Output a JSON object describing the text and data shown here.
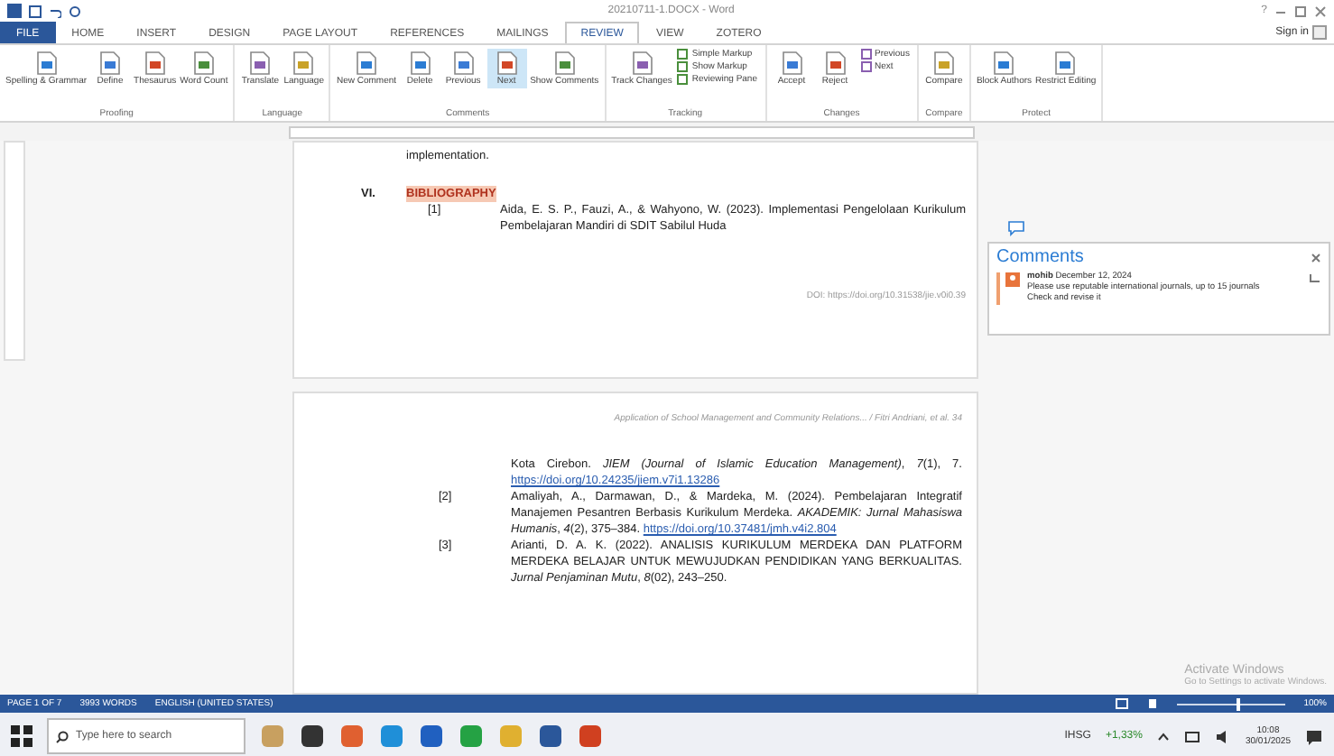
{
  "window": {
    "title": "20210711-1.DOCX - Word",
    "help": "?",
    "sign_in": "Sign in"
  },
  "tabs": [
    {
      "label": "FILE",
      "selected": false
    },
    {
      "label": "HOME",
      "selected": false
    },
    {
      "label": "INSERT",
      "selected": false
    },
    {
      "label": "DESIGN",
      "selected": false
    },
    {
      "label": "PAGE LAYOUT",
      "selected": false
    },
    {
      "label": "REFERENCES",
      "selected": false
    },
    {
      "label": "MAILINGS",
      "selected": false
    },
    {
      "label": "REVIEW",
      "selected": true
    },
    {
      "label": "VIEW",
      "selected": false
    },
    {
      "label": "ZOTERO",
      "selected": false
    }
  ],
  "ribbon_groups": [
    {
      "label": "Proofing",
      "buttons": [
        {
          "kind": "large",
          "label": "Spelling & Grammar",
          "selected": false
        },
        {
          "kind": "large",
          "label": "Define",
          "selected": false
        },
        {
          "kind": "large",
          "label": "Thesaurus",
          "selected": false
        },
        {
          "kind": "large",
          "label": "Word Count",
          "selected": false
        }
      ]
    },
    {
      "label": "Language",
      "buttons": [
        {
          "kind": "large",
          "label": "Translate",
          "selected": false
        },
        {
          "kind": "large",
          "label": "Language",
          "selected": false
        }
      ]
    },
    {
      "label": "Comments",
      "buttons": [
        {
          "kind": "large",
          "label": "New Comment",
          "selected": false
        },
        {
          "kind": "large",
          "label": "Delete",
          "selected": false
        },
        {
          "kind": "large",
          "label": "Previous",
          "selected": false
        },
        {
          "kind": "large",
          "label": "Next",
          "selected": true
        },
        {
          "kind": "large",
          "label": "Show Comments",
          "selected": false
        }
      ]
    },
    {
      "label": "Tracking",
      "buttons": [
        {
          "kind": "large",
          "label": "Track Changes",
          "selected": false
        },
        {
          "kind": "small",
          "label": "Simple Markup",
          "selected": false
        },
        {
          "kind": "small",
          "label": "Show Markup",
          "selected": false
        },
        {
          "kind": "small",
          "label": "Reviewing Pane",
          "selected": false
        }
      ]
    },
    {
      "label": "Changes",
      "buttons": [
        {
          "kind": "large",
          "label": "Accept",
          "selected": false
        },
        {
          "kind": "large",
          "label": "Reject",
          "selected": false
        },
        {
          "kind": "small",
          "label": "Previous",
          "selected": false
        },
        {
          "kind": "small",
          "label": "Next",
          "selected": false
        }
      ]
    },
    {
      "label": "Compare",
      "buttons": [
        {
          "kind": "large",
          "label": "Compare",
          "selected": false
        }
      ]
    },
    {
      "label": "Protect",
      "buttons": [
        {
          "kind": "large",
          "label": "Block Authors",
          "selected": false
        },
        {
          "kind": "large",
          "label": "Restrict Editing",
          "selected": false
        }
      ]
    }
  ],
  "page_1": {
    "text": "implementation.",
    "section_number": "VI.",
    "section_title": "BIBLIOGRAPHY",
    "references": [
      {
        "number": "[1]",
        "text": "Aida, E. S. P., Fauzi, A., & Wahyono, W. (2023). Implementasi Pengelolaan Kurikulum Pembelajaran Mandiri di SDIT Sabilul Huda"
      }
    ],
    "footer": "DOI: https://doi.org/10.31538/jie.v0i0.39"
  },
  "page_2": {
    "header": "Application of School Management and Community Relations... / Fitri Andriani, et al. 34",
    "references": [
      {
        "text": "Kota Cirebon. *JIEM (Journal of Islamic Education Management)*, *7*(1), 7.",
        "link": "https://doi.org/10.24235/jiem.v7i1.13286"
      },
      {
        "number": "[2]",
        "text": "Amaliyah, A., Darmawan, D., & Mardeka, M. (2024). Pembelajaran Integratif Manajemen Pesantren Berbasis Kurikulum Merdeka. *AKADEMIK: Jurnal Mahasiswa Humanis*, *4*(2), 375–384.",
        "link": "https://doi.org/10.37481/jmh.v4i2.804"
      },
      {
        "number": "[3]",
        "text": "Arianti, D. A. K. (2022). ANALISIS KURIKULUM MERDEKA DAN PLATFORM MERDEKA BELAJAR UNTUK MEWUJUDKAN PENDIDIKAN YANG BERKUALITAS. *Jurnal Penjaminan Mutu*, *8*(02), 243–250."
      }
    ]
  },
  "comments_pane": {
    "title": "Comments",
    "comments": [
      {
        "author": "mohib",
        "date": "December 12, 2024",
        "paragraphs": [
          "Please use reputable international journals, up to 15 journals",
          "Check and revise it"
        ]
      }
    ]
  },
  "activation_notice": {
    "title": "Activate Windows",
    "text": "Go to Settings to activate Windows."
  },
  "status_bar": {
    "page": "PAGE 1 OF 7",
    "words": "3993 WORDS",
    "language": "ENGLISH (UNITED STATES)",
    "zoom": {
      "level": 0.55,
      "label": "100%"
    }
  },
  "taskbar": {
    "search_placeholder": "Type here to search",
    "stock_name": "IHSG",
    "stock_change": "+1,33%",
    "time": "10:08",
    "date": "30/01/2025"
  }
}
